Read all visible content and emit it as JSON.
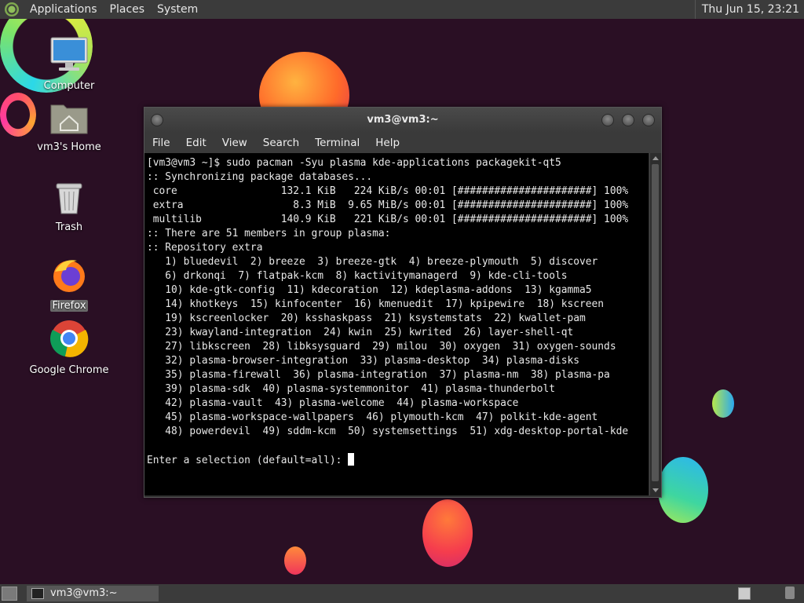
{
  "top_panel": {
    "menus": [
      "Applications",
      "Places",
      "System"
    ],
    "clock": "Thu Jun 15, 23:21"
  },
  "desktop": {
    "icons": [
      {
        "label": "Computer",
        "icon": "computer-icon"
      },
      {
        "label": "vm3's Home",
        "icon": "home-folder-icon"
      },
      {
        "label": "Trash",
        "icon": "trash-icon"
      },
      {
        "label": "Firefox",
        "icon": "firefox-icon"
      },
      {
        "label": "Google Chrome",
        "icon": "chrome-icon"
      }
    ]
  },
  "terminal": {
    "title": "vm3@vm3:~",
    "menus": [
      "File",
      "Edit",
      "View",
      "Search",
      "Terminal",
      "Help"
    ],
    "lines": [
      "[vm3@vm3 ~]$ sudo pacman -Syu plasma kde-applications packagekit-qt5",
      ":: Synchronizing package databases...",
      " core                 132.1 KiB   224 KiB/s 00:01 [######################] 100%",
      " extra                  8.3 MiB  9.65 MiB/s 00:01 [######################] 100%",
      " multilib             140.9 KiB   221 KiB/s 00:01 [######################] 100%",
      ":: There are 51 members in group plasma:",
      ":: Repository extra",
      "   1) bluedevil  2) breeze  3) breeze-gtk  4) breeze-plymouth  5) discover",
      "   6) drkonqi  7) flatpak-kcm  8) kactivitymanagerd  9) kde-cli-tools",
      "   10) kde-gtk-config  11) kdecoration  12) kdeplasma-addons  13) kgamma5",
      "   14) khotkeys  15) kinfocenter  16) kmenuedit  17) kpipewire  18) kscreen",
      "   19) kscreenlocker  20) ksshaskpass  21) ksystemstats  22) kwallet-pam",
      "   23) kwayland-integration  24) kwin  25) kwrited  26) layer-shell-qt",
      "   27) libkscreen  28) libksysguard  29) milou  30) oxygen  31) oxygen-sounds",
      "   32) plasma-browser-integration  33) plasma-desktop  34) plasma-disks",
      "   35) plasma-firewall  36) plasma-integration  37) plasma-nm  38) plasma-pa",
      "   39) plasma-sdk  40) plasma-systemmonitor  41) plasma-thunderbolt",
      "   42) plasma-vault  43) plasma-welcome  44) plasma-workspace",
      "   45) plasma-workspace-wallpapers  46) plymouth-kcm  47) polkit-kde-agent",
      "   48) powerdevil  49) sddm-kcm  50) systemsettings  51) xdg-desktop-portal-kde",
      ""
    ],
    "prompt": "Enter a selection (default=all): "
  },
  "taskbar": {
    "task_label": "vm3@vm3:~"
  }
}
